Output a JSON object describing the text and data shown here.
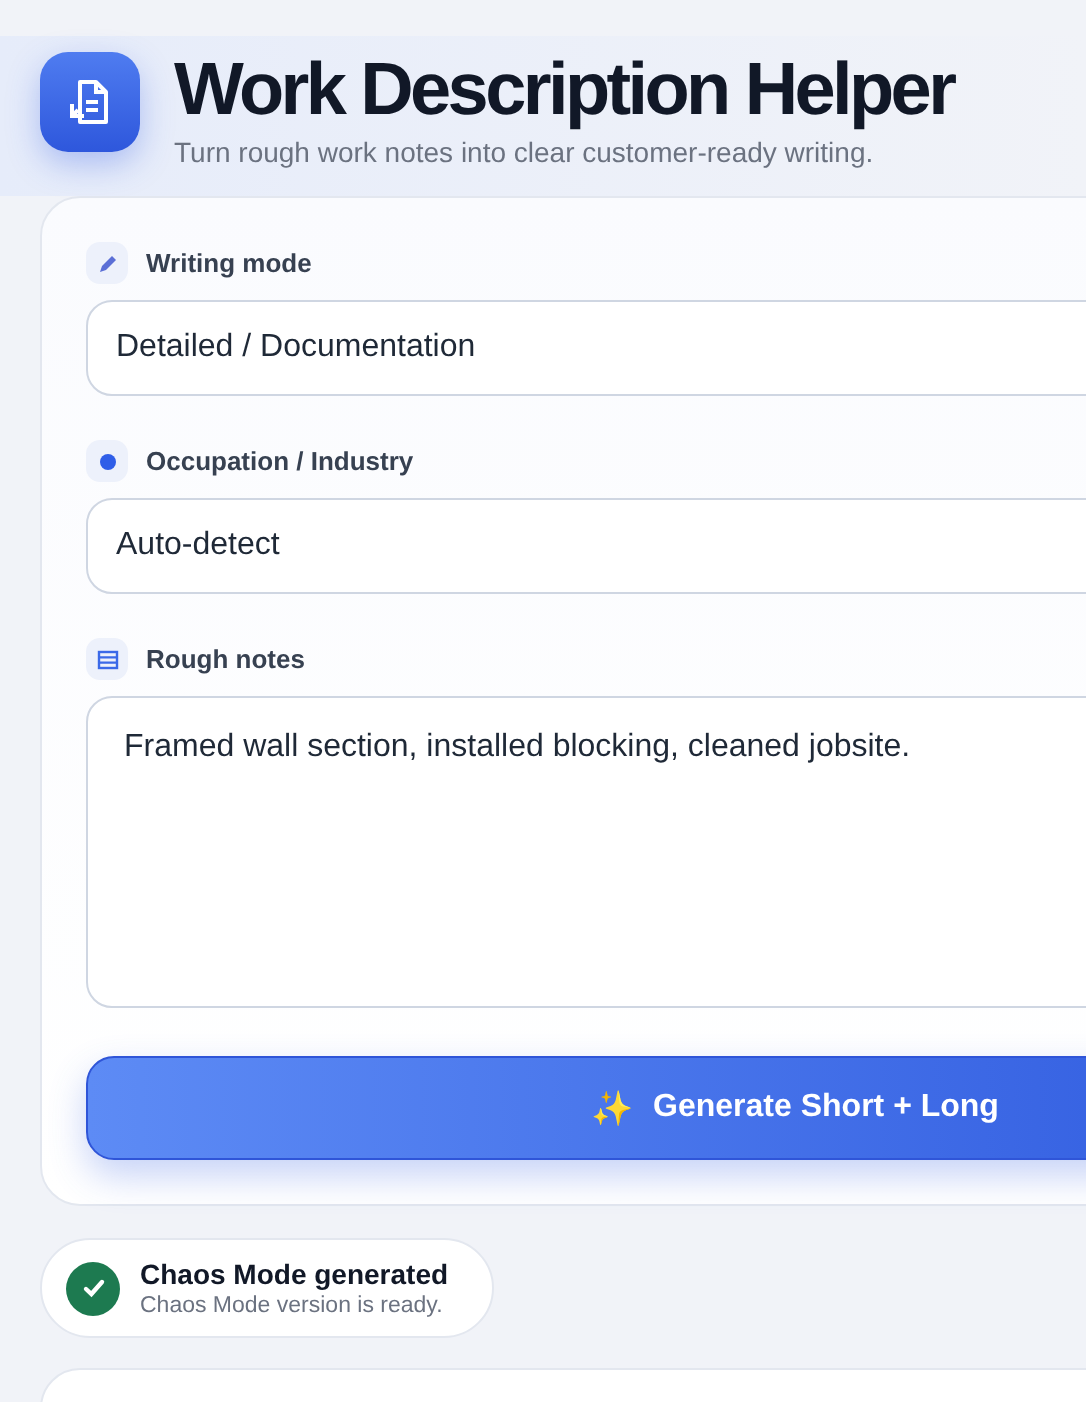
{
  "header": {
    "title": "Work Description Helper",
    "subtitle": "Turn rough work notes into clear customer-ready writing."
  },
  "fields": [
    {
      "kind": "select",
      "label": "Writing mode",
      "value": "Detailed / Documentation"
    },
    {
      "kind": "select",
      "label": "Occupation / Industry",
      "value": "Auto-detect"
    },
    {
      "kind": "textarea",
      "label": "Rough notes",
      "value": "Framed wall section, installed blocking, cleaned jobsite."
    }
  ],
  "generate_button": {
    "icon": "✨",
    "label": "Generate Short + Long"
  },
  "toast": {
    "title": "Chaos Mode generated",
    "message": "Chaos Mode version is ready."
  }
}
